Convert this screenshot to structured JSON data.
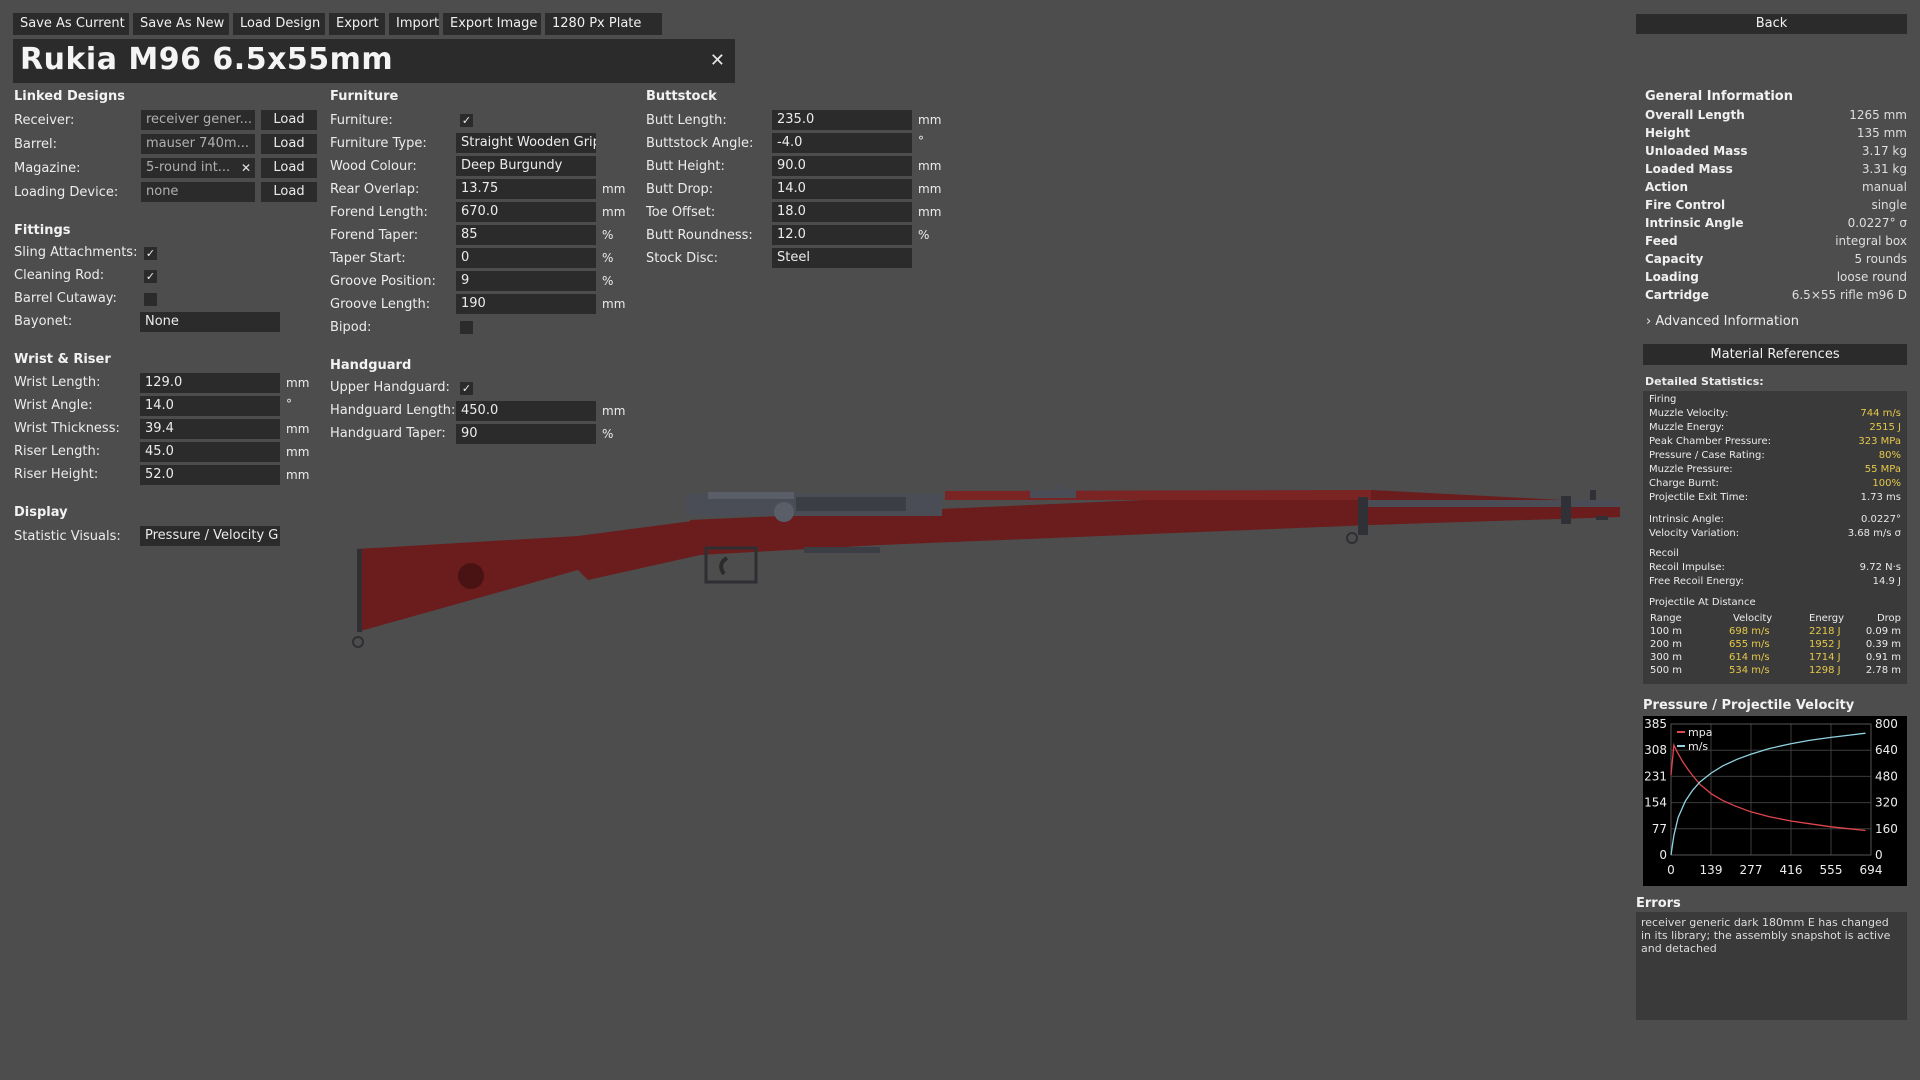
{
  "toolbar": {
    "buttons": [
      "Save As Current",
      "Save As New",
      "Load Design",
      "Export",
      "Import",
      "Export Image",
      "1280 Px Plate"
    ],
    "back_label": "Back"
  },
  "design_title": "Rukia M96 6.5x55mm",
  "linked_designs": {
    "heading": "Linked Designs",
    "rows": [
      {
        "label": "Receiver:",
        "value": "receiver gener...",
        "button": "Load"
      },
      {
        "label": "Barrel:",
        "value": "mauser 740m...",
        "button": "Load"
      },
      {
        "label": "Magazine:",
        "value": "5-round int...",
        "button": "Load"
      },
      {
        "label": "Loading Device:",
        "value": "none",
        "button": "Load"
      }
    ]
  },
  "fittings": {
    "heading": "Fittings",
    "sling_label": "Sling Attachments:",
    "cleaning_label": "Cleaning Rod:",
    "cutaway_label": "Barrel Cutaway:",
    "bayonet_label": "Bayonet:",
    "bayonet_value": "None",
    "sling_checked": true,
    "cleaning_checked": true,
    "cutaway_checked": false
  },
  "wrist_riser": {
    "heading": "Wrist & Riser",
    "rows": [
      {
        "label": "Wrist Length:",
        "value": "129.0",
        "unit": "mm"
      },
      {
        "label": "Wrist Angle:",
        "value": "14.0",
        "unit": "°"
      },
      {
        "label": "Wrist Thickness:",
        "value": "39.4",
        "unit": "mm"
      },
      {
        "label": "Riser Length:",
        "value": "45.0",
        "unit": "mm"
      },
      {
        "label": "Riser Height:",
        "value": "52.0",
        "unit": "mm"
      }
    ]
  },
  "display": {
    "heading": "Display",
    "label": "Statistic Visuals:",
    "value": "Pressure / Velocity G"
  },
  "furniture": {
    "heading": "Furniture",
    "furniture_label": "Furniture:",
    "furniture_checked": true,
    "rows": [
      {
        "label": "Furniture Type:",
        "value": "Straight Wooden Grip",
        "unit": ""
      },
      {
        "label": "Wood Colour:",
        "value": "Deep Burgundy",
        "unit": ""
      },
      {
        "label": "Rear Overlap:",
        "value": "13.75",
        "unit": "mm"
      },
      {
        "label": "Forend Length:",
        "value": "670.0",
        "unit": "mm"
      },
      {
        "label": "Forend Taper:",
        "value": "85",
        "unit": "%"
      },
      {
        "label": "Taper Start:",
        "value": "0",
        "unit": "%"
      },
      {
        "label": "Groove Position:",
        "value": "9",
        "unit": "%"
      },
      {
        "label": "Groove Length:",
        "value": "190",
        "unit": "mm"
      }
    ],
    "bipod_label": "Bipod:",
    "bipod_checked": false
  },
  "handguard": {
    "heading": "Handguard",
    "upper_label": "Upper Handguard:",
    "upper_checked": true,
    "rows": [
      {
        "label": "Handguard Length:",
        "value": "450.0",
        "unit": "mm"
      },
      {
        "label": "Handguard Taper:",
        "value": "90",
        "unit": "%"
      }
    ]
  },
  "buttstock": {
    "heading": "Buttstock",
    "rows": [
      {
        "label": "Butt Length:",
        "value": "235.0",
        "unit": "mm"
      },
      {
        "label": "Buttstock Angle:",
        "value": "-4.0",
        "unit": "°"
      },
      {
        "label": "Butt Height:",
        "value": "90.0",
        "unit": "mm"
      },
      {
        "label": "Butt Drop:",
        "value": "14.0",
        "unit": "mm"
      },
      {
        "label": "Toe Offset:",
        "value": "18.0",
        "unit": "mm"
      },
      {
        "label": "Butt Roundness:",
        "value": "12.0",
        "unit": "%"
      },
      {
        "label": "Stock Disc:",
        "value": "Steel",
        "unit": ""
      }
    ]
  },
  "general": {
    "heading": "General Information",
    "rows": [
      {
        "k": "Overall Length",
        "v": "1265 mm"
      },
      {
        "k": "Height",
        "v": "135 mm"
      },
      {
        "k": "Unloaded Mass",
        "v": "3.17 kg"
      },
      {
        "k": "Loaded Mass",
        "v": "3.31 kg"
      },
      {
        "k": "Action",
        "v": "manual"
      },
      {
        "k": "Fire Control",
        "v": "single"
      },
      {
        "k": "Intrinsic Angle",
        "v": "0.0227° σ"
      },
      {
        "k": "Feed",
        "v": "integral box"
      },
      {
        "k": "Capacity",
        "v": "5 rounds"
      },
      {
        "k": "Loading",
        "v": "loose round"
      },
      {
        "k": "Cartridge",
        "v": "6.5×55 rifle m96 D"
      }
    ],
    "advanced_label": "› Advanced Information",
    "material_label": "Material References"
  },
  "detailed": {
    "heading": "Detailed Statistics:",
    "firing_heading": "Firing",
    "firing": [
      {
        "k": "Muzzle Velocity:",
        "v": "744 m/s",
        "hl": true
      },
      {
        "k": "Muzzle Energy:",
        "v": "2515 J",
        "hl": true
      },
      {
        "k": "Peak Chamber Pressure:",
        "v": "323 MPa",
        "hl": true
      },
      {
        "k": "Pressure / Case Rating:",
        "v": "80%",
        "hl": true
      },
      {
        "k": "Muzzle Pressure:",
        "v": "55 MPa",
        "hl": true
      },
      {
        "k": "Charge Burnt:",
        "v": "100%",
        "hl": true
      },
      {
        "k": "Projectile Exit Time:",
        "v": "1.73 ms",
        "hl": false
      }
    ],
    "angle": [
      {
        "k": "Intrinsic Angle:",
        "v": "0.0227°"
      },
      {
        "k": "Velocity Variation:",
        "v": "3.68 m/s σ"
      }
    ],
    "recoil_heading": "Recoil",
    "recoil": [
      {
        "k": "Recoil Impulse:",
        "v": "9.72 N·s"
      },
      {
        "k": "Free Recoil Energy:",
        "v": "14.9 J"
      }
    ],
    "distance_heading": "Projectile At Distance",
    "distance_cols": [
      "Range",
      "Velocity",
      "Energy",
      "Drop"
    ],
    "distance_rows": [
      [
        "100 m",
        "698 m/s",
        "2218 J",
        "0.09 m"
      ],
      [
        "200 m",
        "655 m/s",
        "1952 J",
        "0.39 m"
      ],
      [
        "300 m",
        "614 m/s",
        "1714 J",
        "0.91 m"
      ],
      [
        "500 m",
        "534 m/s",
        "1298 J",
        "2.78 m"
      ]
    ]
  },
  "chart_title": "Pressure / Projectile Velocity",
  "chart_data": {
    "type": "line",
    "title": "Pressure / Projectile Velocity",
    "x_ticks": [
      "0",
      "139",
      "277",
      "416",
      "555",
      "694"
    ],
    "y_left_ticks": [
      "385",
      "308",
      "231",
      "154",
      "77",
      "0"
    ],
    "y_right_ticks": [
      "800",
      "640",
      "480",
      "320",
      "160",
      "0"
    ],
    "xlim": [
      0,
      694
    ],
    "ylim_left": [
      0,
      385
    ],
    "ylim_right": [
      0,
      800
    ],
    "grid": true,
    "legend": "top-left",
    "series": [
      {
        "name": "mpa",
        "color": "#e0464c",
        "axis": "left",
        "x": [
          0,
          10,
          20,
          40,
          60,
          80,
          100,
          140,
          180,
          220,
          277,
          340,
          416,
          480,
          555,
          620,
          675
        ],
        "y": [
          235,
          323,
          305,
          275,
          250,
          228,
          208,
          180,
          160,
          145,
          127,
          113,
          100,
          92,
          83,
          77,
          72
        ]
      },
      {
        "name": "m/s",
        "color": "#8fd3e0",
        "axis": "right",
        "x": [
          0,
          10,
          25,
          50,
          75,
          100,
          139,
          180,
          230,
          277,
          340,
          416,
          480,
          555,
          620,
          675
        ],
        "y": [
          0,
          120,
          230,
          330,
          395,
          445,
          500,
          545,
          585,
          615,
          650,
          680,
          700,
          718,
          732,
          744
        ]
      }
    ]
  },
  "errors": {
    "heading": "Errors",
    "text": "receiver generic dark 180mm E has changed in its library; the assembly snapshot is active and detached"
  },
  "colors": {
    "background": "#4d4d4d",
    "panel": "#2b2b2b",
    "wood": "#6b1c1c",
    "steel": "#4a4d55",
    "highlight": "#e6c84a"
  }
}
